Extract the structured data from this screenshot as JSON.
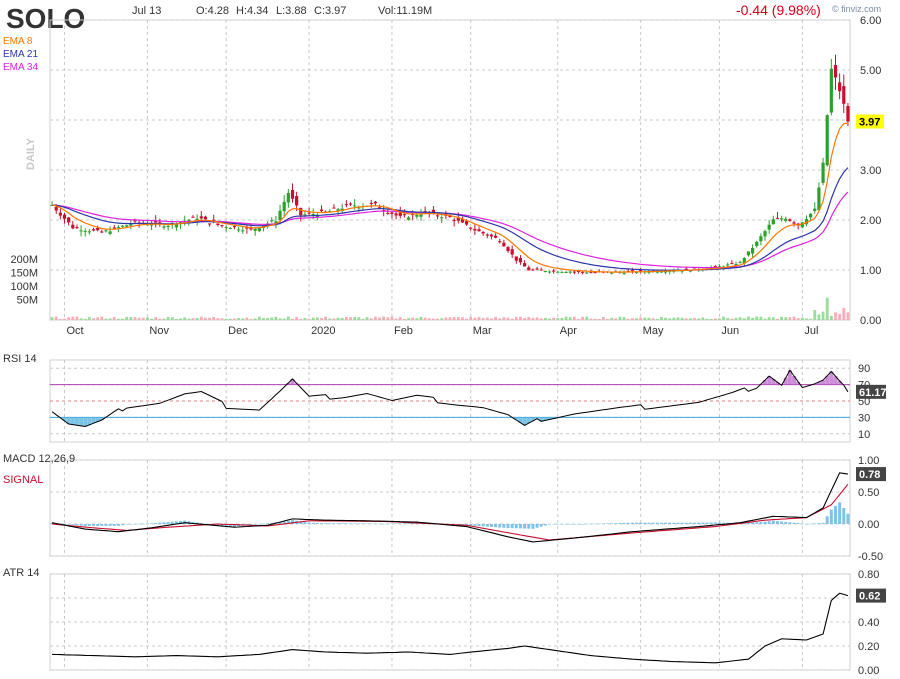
{
  "header": {
    "ticker": "SOLO",
    "date": "Jul 13",
    "open": "O:4.28",
    "high": "H:4.34",
    "low": "L:3.88",
    "close": "C:3.97",
    "volume": "Vol:11.19M",
    "change": "-0.44 (9.98%)",
    "watermark": "© finviz.com",
    "period_label": "DAILY"
  },
  "colors": {
    "up": "#2ca02c",
    "down": "#c8102e",
    "ema8": "#ff7700",
    "ema21": "#2a35a8",
    "ema34": "#e020e0",
    "last_price_bg": "#ffff00",
    "change": "#d4001a"
  },
  "legends": {
    "ema8": "EMA 8",
    "ema21": "EMA 21",
    "ema34": "EMA 34"
  },
  "chart_data": [
    {
      "type": "candlestick",
      "title": "SOLO",
      "y_axis_ticks": [
        "6.00",
        "5.00",
        "4.00",
        "3.00",
        "2.00",
        "1.00",
        "0.00"
      ],
      "ylim": [
        0,
        6
      ],
      "volume_ticks": [
        "200M",
        "150M",
        "100M",
        "50M"
      ],
      "x_ticks": [
        "Oct",
        "Nov",
        "Dec",
        "2020",
        "Feb",
        "Mar",
        "Apr",
        "May",
        "Jun",
        "Jul"
      ],
      "last_price": "3.97",
      "series": [
        {
          "name": "EMA 8",
          "color": "#ff7700"
        },
        {
          "name": "EMA 21",
          "color": "#2a35a8"
        },
        {
          "name": "EMA 34",
          "color": "#e020e0"
        }
      ],
      "anchors": [
        {
          "x": 0,
          "close": 2.3
        },
        {
          "x": 5,
          "close": 1.85
        },
        {
          "x": 12,
          "close": 1.75
        },
        {
          "x": 20,
          "close": 1.95
        },
        {
          "x": 28,
          "close": 1.9
        },
        {
          "x": 35,
          "close": 2.05
        },
        {
          "x": 40,
          "close": 1.9
        },
        {
          "x": 48,
          "close": 1.8
        },
        {
          "x": 54,
          "close": 2.0
        },
        {
          "x": 57,
          "close": 2.55
        },
        {
          "x": 60,
          "close": 2.1
        },
        {
          "x": 66,
          "close": 2.15
        },
        {
          "x": 72,
          "close": 2.3
        },
        {
          "x": 78,
          "close": 2.3
        },
        {
          "x": 84,
          "close": 2.05
        },
        {
          "x": 90,
          "close": 2.15
        },
        {
          "x": 96,
          "close": 2.05
        },
        {
          "x": 102,
          "close": 1.8
        },
        {
          "x": 108,
          "close": 1.6
        },
        {
          "x": 112,
          "close": 1.2
        },
        {
          "x": 115,
          "close": 1.0
        },
        {
          "x": 122,
          "close": 0.98
        },
        {
          "x": 132,
          "close": 0.95
        },
        {
          "x": 142,
          "close": 0.97
        },
        {
          "x": 152,
          "close": 1.0
        },
        {
          "x": 160,
          "close": 1.05
        },
        {
          "x": 166,
          "close": 1.15
        },
        {
          "x": 170,
          "close": 1.55
        },
        {
          "x": 174,
          "close": 2.0
        },
        {
          "x": 177,
          "close": 2.05
        },
        {
          "x": 180,
          "close": 1.9
        },
        {
          "x": 184,
          "close": 2.2
        },
        {
          "x": 186,
          "close": 3.1
        },
        {
          "x": 187,
          "close": 4.1
        },
        {
          "x": 188,
          "close": 5.0
        },
        {
          "x": 190,
          "close": 4.6
        },
        {
          "x": 192,
          "close": 3.97
        }
      ],
      "n_bars": 193
    },
    {
      "type": "line",
      "title": "RSI 14",
      "y_axis_ticks": [
        "90",
        "70",
        "50",
        "30",
        "10"
      ],
      "ylim": [
        0,
        100
      ],
      "last_value": "61.17",
      "anchors": [
        {
          "x": 0,
          "y": 38
        },
        {
          "x": 4,
          "y": 22
        },
        {
          "x": 8,
          "y": 18
        },
        {
          "x": 12,
          "y": 25
        },
        {
          "x": 18,
          "y": 44
        },
        {
          "x": 26,
          "y": 48
        },
        {
          "x": 32,
          "y": 58
        },
        {
          "x": 36,
          "y": 60
        },
        {
          "x": 42,
          "y": 44
        },
        {
          "x": 50,
          "y": 40
        },
        {
          "x": 55,
          "y": 62
        },
        {
          "x": 58,
          "y": 76
        },
        {
          "x": 62,
          "y": 54
        },
        {
          "x": 70,
          "y": 56
        },
        {
          "x": 76,
          "y": 60
        },
        {
          "x": 82,
          "y": 50
        },
        {
          "x": 88,
          "y": 55
        },
        {
          "x": 96,
          "y": 48
        },
        {
          "x": 104,
          "y": 42
        },
        {
          "x": 110,
          "y": 32
        },
        {
          "x": 114,
          "y": 18
        },
        {
          "x": 118,
          "y": 28
        },
        {
          "x": 126,
          "y": 35
        },
        {
          "x": 136,
          "y": 40
        },
        {
          "x": 146,
          "y": 44
        },
        {
          "x": 156,
          "y": 48
        },
        {
          "x": 164,
          "y": 58
        },
        {
          "x": 170,
          "y": 68
        },
        {
          "x": 173,
          "y": 82
        },
        {
          "x": 176,
          "y": 70
        },
        {
          "x": 178,
          "y": 88
        },
        {
          "x": 181,
          "y": 66
        },
        {
          "x": 184,
          "y": 70
        },
        {
          "x": 186,
          "y": 74
        },
        {
          "x": 188,
          "y": 84
        },
        {
          "x": 190,
          "y": 72
        },
        {
          "x": 192,
          "y": 61.17
        }
      ]
    },
    {
      "type": "line",
      "title": "MACD 12,26,9",
      "legend": [
        "SIGNAL"
      ],
      "y_axis_ticks": [
        "1.00",
        "0.50",
        "0.00",
        "-0.50"
      ],
      "ylim": [
        -0.5,
        1.0
      ],
      "last_value": "0.78",
      "macd_anchors": [
        {
          "x": 0,
          "y": 0.02
        },
        {
          "x": 8,
          "y": -0.08
        },
        {
          "x": 16,
          "y": -0.12
        },
        {
          "x": 24,
          "y": -0.06
        },
        {
          "x": 32,
          "y": 0.02
        },
        {
          "x": 44,
          "y": -0.05
        },
        {
          "x": 52,
          "y": -0.02
        },
        {
          "x": 58,
          "y": 0.08
        },
        {
          "x": 66,
          "y": 0.06
        },
        {
          "x": 76,
          "y": 0.05
        },
        {
          "x": 88,
          "y": 0.03
        },
        {
          "x": 100,
          "y": -0.04
        },
        {
          "x": 110,
          "y": -0.2
        },
        {
          "x": 116,
          "y": -0.28
        },
        {
          "x": 126,
          "y": -0.22
        },
        {
          "x": 140,
          "y": -0.12
        },
        {
          "x": 156,
          "y": -0.04
        },
        {
          "x": 166,
          "y": 0.02
        },
        {
          "x": 174,
          "y": 0.12
        },
        {
          "x": 182,
          "y": 0.1
        },
        {
          "x": 186,
          "y": 0.25
        },
        {
          "x": 190,
          "y": 0.8
        },
        {
          "x": 192,
          "y": 0.78
        }
      ],
      "signal_anchors": [
        {
          "x": 0,
          "y": 0.0
        },
        {
          "x": 10,
          "y": -0.06
        },
        {
          "x": 18,
          "y": -0.1
        },
        {
          "x": 28,
          "y": -0.05
        },
        {
          "x": 40,
          "y": 0.0
        },
        {
          "x": 52,
          "y": -0.03
        },
        {
          "x": 62,
          "y": 0.05
        },
        {
          "x": 80,
          "y": 0.04
        },
        {
          "x": 100,
          "y": -0.02
        },
        {
          "x": 112,
          "y": -0.16
        },
        {
          "x": 120,
          "y": -0.25
        },
        {
          "x": 140,
          "y": -0.14
        },
        {
          "x": 160,
          "y": -0.04
        },
        {
          "x": 172,
          "y": 0.06
        },
        {
          "x": 182,
          "y": 0.1
        },
        {
          "x": 188,
          "y": 0.3
        },
        {
          "x": 192,
          "y": 0.62
        }
      ]
    },
    {
      "type": "line",
      "title": "ATR 14",
      "y_axis_ticks": [
        "0.80",
        "0.60",
        "0.40",
        "0.20",
        "0.00"
      ],
      "ylim": [
        0,
        0.8
      ],
      "last_value": "0.62",
      "anchors": [
        {
          "x": 0,
          "y": 0.13
        },
        {
          "x": 10,
          "y": 0.12
        },
        {
          "x": 20,
          "y": 0.11
        },
        {
          "x": 30,
          "y": 0.12
        },
        {
          "x": 40,
          "y": 0.11
        },
        {
          "x": 50,
          "y": 0.13
        },
        {
          "x": 58,
          "y": 0.17
        },
        {
          "x": 66,
          "y": 0.15
        },
        {
          "x": 76,
          "y": 0.14
        },
        {
          "x": 86,
          "y": 0.15
        },
        {
          "x": 96,
          "y": 0.13
        },
        {
          "x": 104,
          "y": 0.16
        },
        {
          "x": 110,
          "y": 0.18
        },
        {
          "x": 114,
          "y": 0.2
        },
        {
          "x": 120,
          "y": 0.17
        },
        {
          "x": 130,
          "y": 0.12
        },
        {
          "x": 140,
          "y": 0.09
        },
        {
          "x": 150,
          "y": 0.07
        },
        {
          "x": 160,
          "y": 0.06
        },
        {
          "x": 168,
          "y": 0.09
        },
        {
          "x": 172,
          "y": 0.2
        },
        {
          "x": 176,
          "y": 0.26
        },
        {
          "x": 182,
          "y": 0.25
        },
        {
          "x": 186,
          "y": 0.3
        },
        {
          "x": 188,
          "y": 0.58
        },
        {
          "x": 190,
          "y": 0.64
        },
        {
          "x": 192,
          "y": 0.62
        }
      ]
    }
  ]
}
